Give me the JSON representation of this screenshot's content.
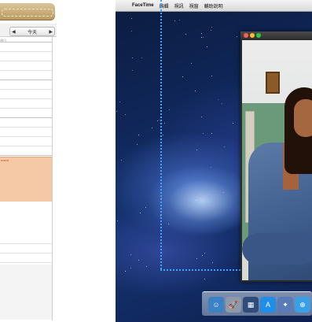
{
  "calendar": {
    "nav": {
      "prev": "◀",
      "label": "今天",
      "next": "▶"
    },
    "header_hint": "週日",
    "event_label": "event"
  },
  "menubar": {
    "apple": "",
    "app_name": "FaceTime",
    "items": [
      "編輯",
      "視訊",
      "視窗",
      "輔助說明"
    ]
  },
  "facetime": {
    "traffic_lights": {
      "close": "#ff5f57",
      "minimize": "#ffbd2e",
      "zoom": "#28c940"
    }
  },
  "dock": {
    "icons": [
      {
        "name": "finder-icon",
        "glyph": "☺",
        "color": "#3b82c4"
      },
      {
        "name": "launchpad-icon",
        "glyph": "🚀",
        "color": "#8e9aa8"
      },
      {
        "name": "mission-control-icon",
        "glyph": "▦",
        "color": "#2f4d7a"
      },
      {
        "name": "app-store-icon",
        "glyph": "A",
        "color": "#1f8ee8"
      },
      {
        "name": "preview-icon",
        "glyph": "✦",
        "color": "#5a7ab8"
      },
      {
        "name": "safari-icon",
        "glyph": "⊕",
        "color": "#3aa0e6"
      }
    ]
  },
  "colors": {
    "guide": "#3fa3ff",
    "event_fill": "#f6c9a6"
  }
}
